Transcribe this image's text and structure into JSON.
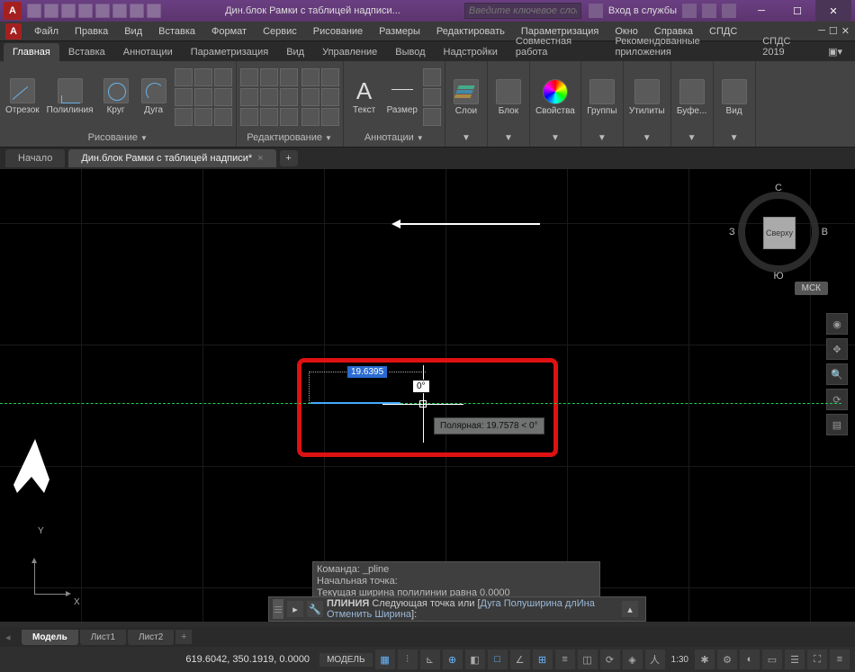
{
  "titlebar": {
    "logo_letter": "A",
    "doc_title": "Дин.блок Рамки с таблицей надписи...",
    "search_placeholder": "Введите ключевое слово/фразу",
    "signin": "Вход в службы"
  },
  "menus": [
    "Файл",
    "Правка",
    "Вид",
    "Вставка",
    "Формат",
    "Сервис",
    "Рисование",
    "Размеры",
    "Редактировать",
    "Параметризация",
    "Окно",
    "Справка",
    "СПДС"
  ],
  "ribbon_tabs": [
    "Главная",
    "Вставка",
    "Аннотации",
    "Параметризация",
    "Вид",
    "Управление",
    "Вывод",
    "Надстройки",
    "Совместная работа",
    "Рекомендованные приложения",
    "СПДС 2019"
  ],
  "ribbon": {
    "draw": {
      "title": "Рисование",
      "line": "Отрезок",
      "pline": "Полилиния",
      "circle": "Круг",
      "arc": "Дуга"
    },
    "modify": {
      "title": "Редактирование"
    },
    "annot": {
      "title": "Аннотации",
      "text": "Текст",
      "dim": "Размер"
    },
    "layers": {
      "title": "Слои",
      "btn": "Слои"
    },
    "block": {
      "title": "Блок",
      "btn": "Блок"
    },
    "props": {
      "title": "Свойства",
      "btn": "Свойства"
    },
    "groups": {
      "title": "Группы",
      "btn": "Группы"
    },
    "utils": {
      "title": "Утилиты",
      "btn": "Утилиты"
    },
    "clip": {
      "title": "Буфе...",
      "btn": "Буфе..."
    },
    "view": {
      "title": "Вид",
      "btn": "Вид"
    }
  },
  "file_tabs": {
    "start": "Начало",
    "active": "Дин.блок Рамки с таблицей надписи*"
  },
  "viewcube": {
    "face": "Сверху",
    "n": "С",
    "s": "Ю",
    "e": "В",
    "w": "З",
    "wcs": "МСК"
  },
  "dyn": {
    "dist": "19.6395",
    "angle": "0°",
    "tooltip": "Полярная: 19.7578 < 0°"
  },
  "cmd": {
    "hist1": "Команда: _pline",
    "hist2": "Начальная точка:",
    "hist3": "Текущая ширина полилинии равна 0.0000",
    "prefix": "ПЛИНИЯ",
    "prompt": "Следующая  точка  или [",
    "opt_arc": "Дуга",
    "opt_hw": "Полуширина",
    "opt_len": "длИна",
    "opt_undo": "Отменить",
    "opt_w": "Ширина",
    "suffix": "]:"
  },
  "layout_tabs": [
    "Модель",
    "Лист1",
    "Лист2"
  ],
  "status": {
    "coords": "619.6042, 350.1919, 0.0000",
    "model": "МОДЕЛЬ",
    "scale": "1:30"
  },
  "ucs": {
    "x": "X",
    "y": "Y"
  }
}
